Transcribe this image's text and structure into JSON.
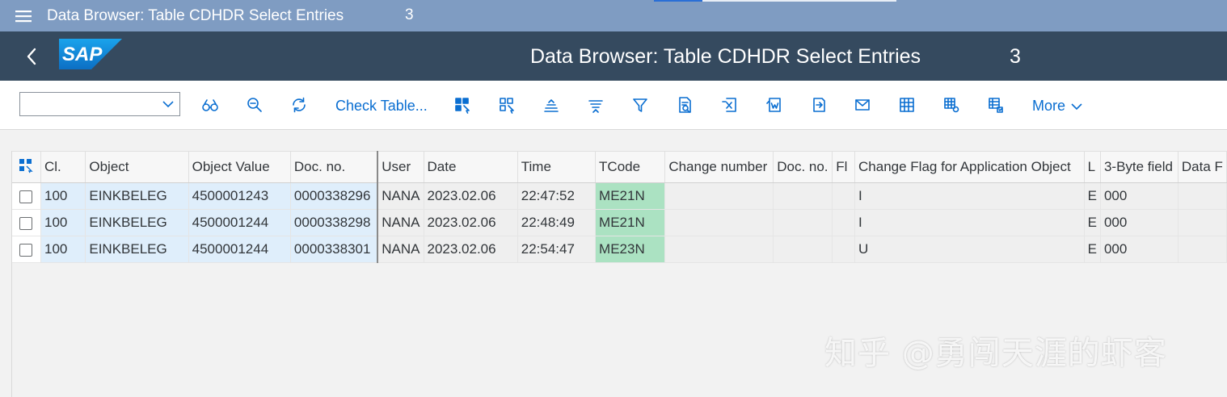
{
  "window": {
    "title": "Data Browser: Table CDHDR Select Entries",
    "count": "3"
  },
  "shell": {
    "logo_text": "SAP",
    "title": "Data Browser: Table CDHDR Select Entries",
    "count": "3"
  },
  "toolbar": {
    "dropdown_value": "",
    "check_table_label": "Check Table...",
    "more_label": "More"
  },
  "table": {
    "columns": [
      "Cl.",
      "Object",
      "Object Value",
      "Doc. no.",
      "User",
      "Date",
      "Time",
      "TCode",
      "Change number",
      "Doc. no.",
      "Fl",
      "Change Flag for Application Object",
      "L",
      "3-Byte field",
      "Data F"
    ],
    "rows": [
      {
        "cl": "100",
        "object": "EINKBELEG",
        "object_value": "4500001243",
        "doc_no": "0000338296",
        "user": "NANA",
        "date": "2023.02.06",
        "time": "22:47:52",
        "tcode": "ME21N",
        "change_number": "",
        "doc_no2": "",
        "fl": "",
        "change_flag": "I",
        "l": "E",
        "byte3": "000",
        "data_f": ""
      },
      {
        "cl": "100",
        "object": "EINKBELEG",
        "object_value": "4500001244",
        "doc_no": "0000338298",
        "user": "NANA",
        "date": "2023.02.06",
        "time": "22:48:49",
        "tcode": "ME21N",
        "change_number": "",
        "doc_no2": "",
        "fl": "",
        "change_flag": "I",
        "l": "E",
        "byte3": "000",
        "data_f": ""
      },
      {
        "cl": "100",
        "object": "EINKBELEG",
        "object_value": "4500001244",
        "doc_no": "0000338301",
        "user": "NANA",
        "date": "2023.02.06",
        "time": "22:54:47",
        "tcode": "ME23N",
        "change_number": "",
        "doc_no2": "",
        "fl": "",
        "change_flag": "U",
        "l": "E",
        "byte3": "000",
        "data_f": ""
      }
    ]
  },
  "watermark": "知乎 @勇闯天涯的虾客",
  "colors": {
    "title_bar": "#7f9cc2",
    "shell_bar": "#354a5f",
    "accent": "#0a6ed1",
    "key_cell": "#dfeefb",
    "tcode_cell": "#abe2c2"
  }
}
